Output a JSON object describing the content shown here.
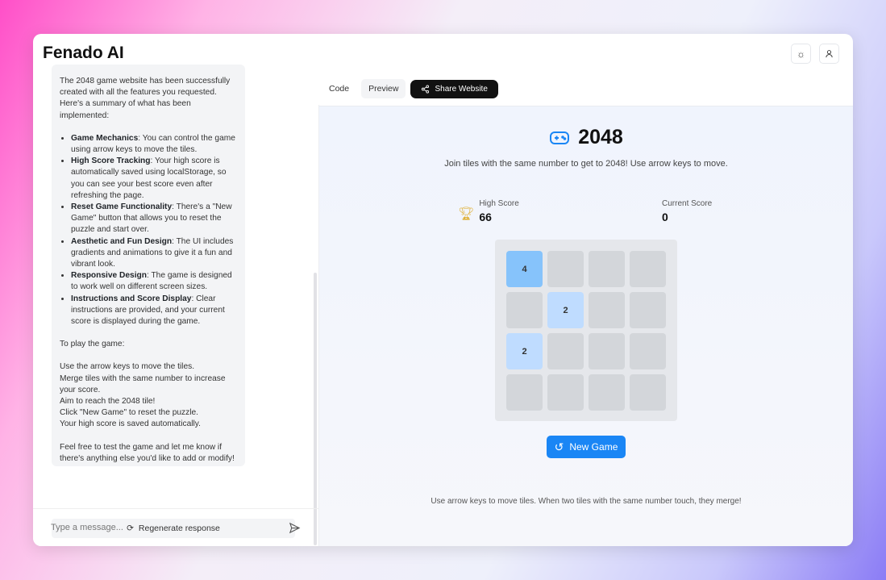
{
  "app": {
    "title": "Fenado AI",
    "theme_icon": "sun-icon",
    "user_icon": "user-icon"
  },
  "chat": {
    "intro": "The 2048 game website has been successfully created with all the features you requested. Here's a summary of what has been implemented:",
    "features": [
      {
        "title": "Game Mechanics",
        "text": ": You can control the game using arrow keys to move the tiles."
      },
      {
        "title": "High Score Tracking",
        "text": ": Your high score is automatically saved using localStorage, so you can see your best score even after refreshing the page."
      },
      {
        "title": "Reset Game Functionality",
        "text": ": There's a \"New Game\" button that allows you to reset the puzzle and start over."
      },
      {
        "title": "Aesthetic and Fun Design",
        "text": ": The UI includes gradients and animations to give it a fun and vibrant look."
      },
      {
        "title": "Responsive Design",
        "text": ": The game is designed to work well on different screen sizes."
      },
      {
        "title": "Instructions and Score Display",
        "text": ": Clear instructions are provided, and your current score is displayed during the game."
      }
    ],
    "play_heading": "To play the game:",
    "steps": [
      "Use the arrow keys to move the tiles.",
      "Merge tiles with the same number to increase your score.",
      "Aim to reach the 2048 tile!",
      "Click \"New Game\" to reset the puzzle.",
      "Your high score is saved automatically."
    ],
    "closing": "Feel free to test the game and let me know if there's anything else you'd like to add or modify!",
    "regenerate_label": "Regenerate response",
    "input_placeholder": "Type a message..."
  },
  "tabs": {
    "code": "Code",
    "preview": "Preview",
    "share": "Share Website",
    "active": "Preview"
  },
  "game": {
    "title": "2048",
    "subtitle": "Join tiles with the same number to get to 2048! Use arrow keys to move.",
    "high_score_label": "High Score",
    "high_score": "66",
    "current_score_label": "Current Score",
    "current_score": "0",
    "board": [
      [
        4,
        0,
        0,
        0
      ],
      [
        0,
        2,
        0,
        0
      ],
      [
        2,
        0,
        0,
        0
      ],
      [
        0,
        0,
        0,
        0
      ]
    ],
    "tile_colors": {
      "0": "#d3d6da",
      "2": "#bfdcff",
      "4": "#86c3fb"
    },
    "new_game_label": "New Game",
    "footer": "Use arrow keys to move tiles. When two tiles with the same number touch, they merge!",
    "accent": "#1a86f5"
  }
}
